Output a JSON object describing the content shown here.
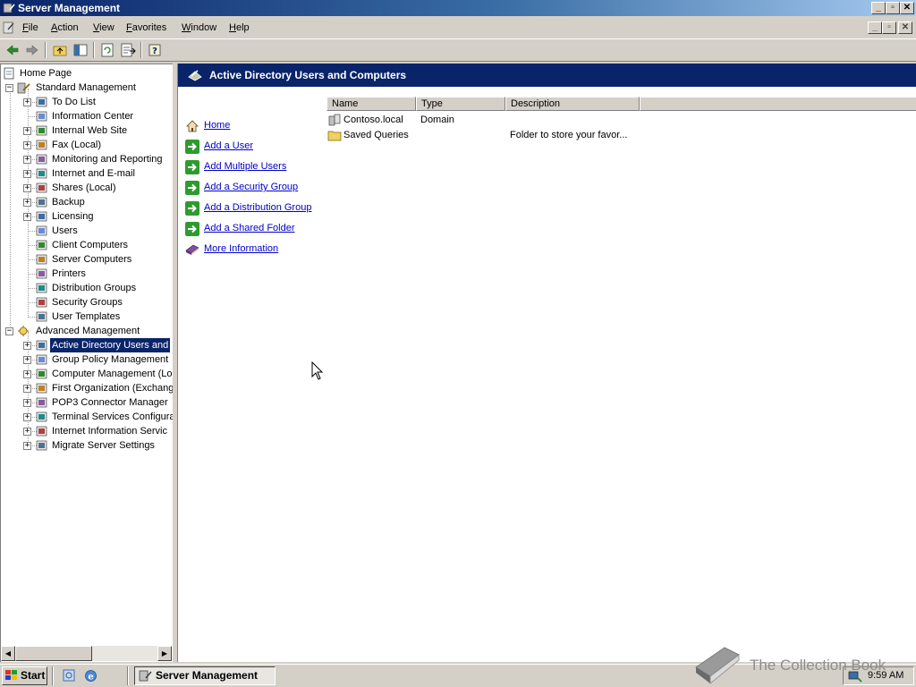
{
  "window": {
    "title": "Server Management",
    "controls": [
      "minimize",
      "maximize",
      "close"
    ]
  },
  "menu": {
    "items": [
      {
        "label": "File"
      },
      {
        "label": "Action"
      },
      {
        "label": "View"
      },
      {
        "label": "Favorites"
      },
      {
        "label": "Window"
      },
      {
        "label": "Help"
      }
    ]
  },
  "toolbar": {
    "buttons": [
      "back-arrow-icon",
      "forward-arrow-icon",
      "up-folder-icon",
      "show-hide-tree-icon",
      "refresh-icon",
      "export-list-icon",
      "help-icon"
    ]
  },
  "tree": {
    "home": "Home Page",
    "standard": {
      "label": "Standard Management",
      "children": [
        {
          "label": "To Do List",
          "expandable": true
        },
        {
          "label": "Information Center",
          "expandable": false
        },
        {
          "label": "Internal Web Site",
          "expandable": true
        },
        {
          "label": "Fax (Local)",
          "expandable": true
        },
        {
          "label": "Monitoring and Reporting",
          "expandable": true
        },
        {
          "label": "Internet and E-mail",
          "expandable": true
        },
        {
          "label": "Shares (Local)",
          "expandable": true
        },
        {
          "label": "Backup",
          "expandable": true
        },
        {
          "label": "Licensing",
          "expandable": true
        },
        {
          "label": "Users",
          "expandable": false
        },
        {
          "label": "Client Computers",
          "expandable": false
        },
        {
          "label": "Server Computers",
          "expandable": false
        },
        {
          "label": "Printers",
          "expandable": false
        },
        {
          "label": "Distribution Groups",
          "expandable": false
        },
        {
          "label": "Security Groups",
          "expandable": false
        },
        {
          "label": "User Templates",
          "expandable": false
        }
      ]
    },
    "advanced": {
      "label": "Advanced Management",
      "children": [
        {
          "label": "Active Directory Users and",
          "expandable": true,
          "selected": true
        },
        {
          "label": "Group Policy Management",
          "expandable": true
        },
        {
          "label": "Computer Management (Lo",
          "expandable": true
        },
        {
          "label": "First Organization (Exchang",
          "expandable": true
        },
        {
          "label": "POP3 Connector Manager",
          "expandable": true
        },
        {
          "label": "Terminal Services Configura",
          "expandable": true
        },
        {
          "label": "Internet Information Servic",
          "expandable": true
        },
        {
          "label": "Migrate Server Settings",
          "expandable": true
        }
      ]
    }
  },
  "rightpane": {
    "header": "Active Directory Users and Computers",
    "tasks": [
      {
        "label": "Home",
        "icon": "home-icon"
      },
      {
        "label": "Add a User",
        "icon": "green-arrow-icon"
      },
      {
        "label": "Add Multiple Users",
        "icon": "green-arrow-icon"
      },
      {
        "label": "Add a Security Group",
        "icon": "green-arrow-icon"
      },
      {
        "label": "Add a Distribution Group",
        "icon": "green-arrow-icon"
      },
      {
        "label": "Add a Shared Folder",
        "icon": "green-arrow-icon"
      },
      {
        "label": "More Information",
        "icon": "book-icon"
      }
    ],
    "columns": [
      "Name",
      "Type",
      "Description"
    ],
    "rows": [
      {
        "name": "Contoso.local",
        "type": "Domain",
        "description": "",
        "icon": "domain-icon"
      },
      {
        "name": "Saved Queries",
        "type": "",
        "description": "Folder to store your favor...",
        "icon": "folder-icon"
      }
    ]
  },
  "taskbar": {
    "start_label": "Start",
    "task_label": "Server Management",
    "clock": "9:59 AM"
  },
  "watermark": "The Collection Book",
  "colors": {
    "titlebar_start": "#0a246a",
    "titlebar_end": "#a6caf0",
    "selection": "#0a246a",
    "link": "#0000cc",
    "face": "#d4d0c8"
  }
}
